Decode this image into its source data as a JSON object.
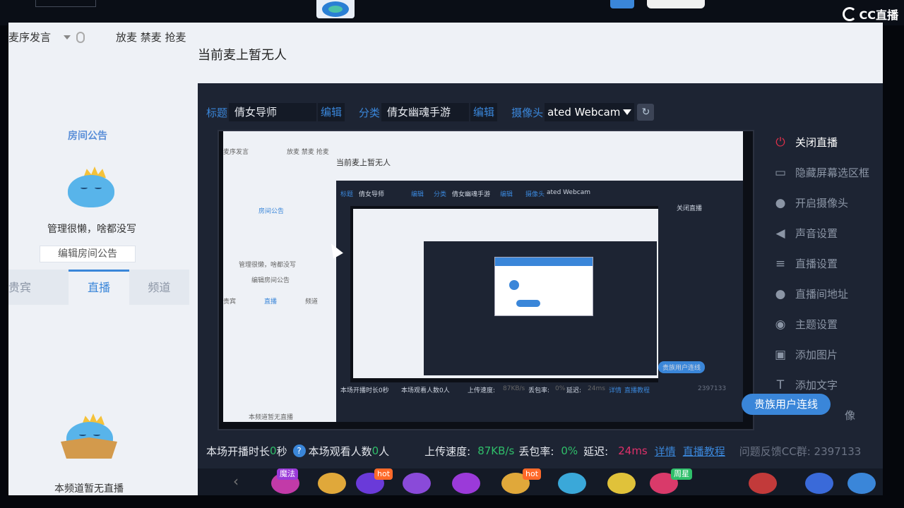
{
  "top": {
    "brand": "CC直播"
  },
  "left": {
    "mic_order_label": "麦序发言",
    "mic_actions": "放麦 禁麦 抢麦",
    "notice_title": "房间公告",
    "notice_text": "管理很懒，啥都没写",
    "edit_notice_button": "编辑房间公告",
    "tabs": [
      "贵宾",
      "直播",
      "频道"
    ],
    "active_tab": "直播",
    "no_live_text": "本频道暂无直播"
  },
  "main": {
    "mic_status": "当前麦上暂无人",
    "title_label": "标题",
    "title_value": "倩女导师",
    "category_label": "分类",
    "category_value": "倩女幽魂手游",
    "edit_label": "编辑",
    "camera_label": "摄像头",
    "camera_value": "ated Webcam",
    "side_menu": [
      {
        "label": "关闭直播",
        "icon": "power-icon"
      },
      {
        "label": "隐藏屏幕选区框",
        "icon": "monitor-icon"
      },
      {
        "label": "开启摄像头",
        "icon": "camera-pin-icon"
      },
      {
        "label": "声音设置",
        "icon": "speaker-icon"
      },
      {
        "label": "直播设置",
        "icon": "sliders-icon"
      },
      {
        "label": "直播间地址",
        "icon": "location-icon"
      },
      {
        "label": "主题设置",
        "icon": "palette-icon"
      },
      {
        "label": "添加图片",
        "icon": "image-icon"
      },
      {
        "label": "添加文字",
        "icon": "text-icon"
      }
    ],
    "vip_connect_button": "贵族用户连线",
    "menu_tail_text": "像",
    "stats": {
      "duration_label": "本场开播时长",
      "duration_value": "0",
      "duration_unit": "秒",
      "viewers_label": "本场观看人数",
      "viewers_value": "0",
      "viewers_unit": "人",
      "upload_label": "上传速度:",
      "upload_value": "87KB/s",
      "loss_label": "丢包率:",
      "loss_value": "0%",
      "delay_label": "延迟:",
      "delay_value": "24ms",
      "detail_link": "详情",
      "tutorial_link": "直播教程",
      "feedback_text": "问题反馈CC群: 2397133"
    },
    "gift_badges": [
      "魔法",
      "hot",
      "hot",
      "周星"
    ]
  },
  "preview": {
    "mic_order": "麦序发言",
    "mic_actions": "放麦 禁麦 抢麦",
    "mic_status": "当前麦上暂无人",
    "notice_title": "房间公告",
    "notice_text": "管理很懒，啥都没写",
    "edit_notice": "编辑房间公告",
    "tab1": "贵宾",
    "tab2": "直播",
    "tab3": "频道",
    "no_live": "本频道暂无直播",
    "title_label": "标题",
    "title_value": "倩女导师",
    "edit_label": "编辑",
    "category_label": "分类",
    "category_value": "倩女幽魂手游",
    "camera_label": "摄像头",
    "camera_value": "ated Webcam",
    "close_live": "关闭直播",
    "vip_connect": "贵族用户连线",
    "stats_left": "本场开播时长0秒",
    "stats_viewers": "本场观看人数0人",
    "upload_label": "上传速度:",
    "upload_value": "87KB/s",
    "loss_label": "丢包率:",
    "loss_value": "0%",
    "delay_label": "延迟:",
    "delay_value": "24ms",
    "detail_link": "详情",
    "tutorial_link": "直播教程",
    "group_number": "2397133"
  }
}
